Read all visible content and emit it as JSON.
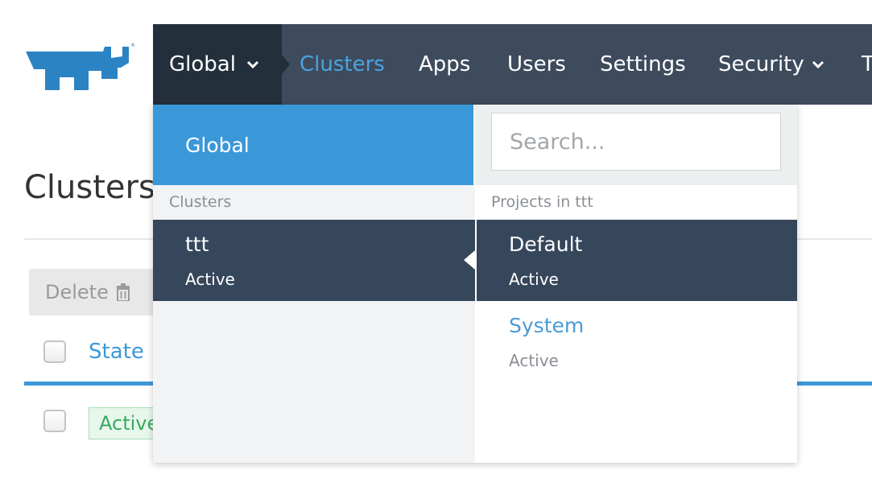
{
  "nav": {
    "global_label": "Global",
    "items": [
      {
        "label": "Clusters",
        "active": true
      },
      {
        "label": "Apps"
      },
      {
        "label": "Users"
      },
      {
        "label": "Settings"
      },
      {
        "label": "Security"
      },
      {
        "label": "T"
      }
    ]
  },
  "page": {
    "title": "Clusters",
    "delete_label": "Delete",
    "state_header": "State",
    "row_state": "Active"
  },
  "dropdown": {
    "global_item": "Global",
    "search_placeholder": "Search...",
    "clusters_label": "Clusters",
    "projects_label": "Projects in ttt",
    "cluster": {
      "name": "ttt",
      "status": "Active"
    },
    "projects": [
      {
        "name": "Default",
        "status": "Active"
      },
      {
        "name": "System",
        "status": "Active"
      }
    ]
  },
  "colors": {
    "nav_bg": "#3d4b5d",
    "nav_dark": "#232f3b",
    "accent": "#3a98d9",
    "selected_row": "#36475c",
    "success": "#3aa860"
  }
}
